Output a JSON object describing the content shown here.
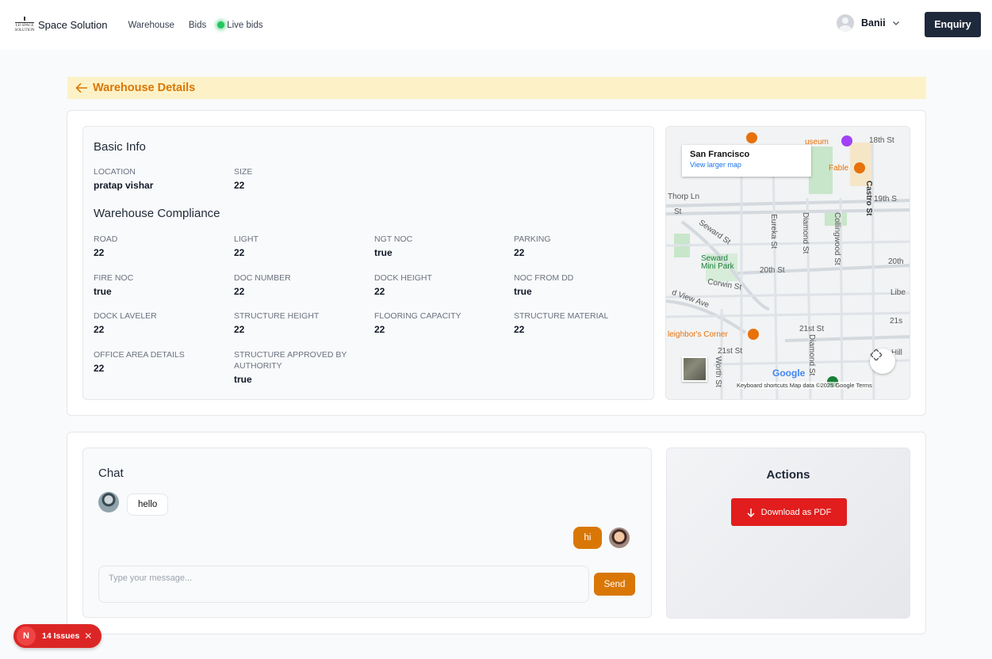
{
  "nav": {
    "logo_line1": "LIJ SPACE",
    "logo_line2": "SOLUTION",
    "brand": "Space Solution",
    "links": [
      "Warehouse",
      "Bids"
    ],
    "live_label": "Live bids",
    "user_name": "Banii",
    "enquiry_label": "Enquiry"
  },
  "header": {
    "back_label": "Warehouse Details"
  },
  "basic_info": {
    "title": "Basic Info",
    "fields": [
      {
        "label": "LOCATION",
        "value": "pratap vishar"
      },
      {
        "label": "SIZE",
        "value": "22"
      }
    ]
  },
  "compliance": {
    "title": "Warehouse Compliance",
    "fields": [
      {
        "label": "ROAD",
        "value": "22"
      },
      {
        "label": "LIGHT",
        "value": "22"
      },
      {
        "label": "NGT NOC",
        "value": "true"
      },
      {
        "label": "PARKING",
        "value": "22"
      },
      {
        "label": "FIRE NOC",
        "value": "true"
      },
      {
        "label": "DOC NUMBER",
        "value": "22"
      },
      {
        "label": "DOCK HEIGHT",
        "value": "22"
      },
      {
        "label": "NOC FROM DD",
        "value": "true"
      },
      {
        "label": "DOCK LAVELER",
        "value": "22"
      },
      {
        "label": "STRUCTURE HEIGHT",
        "value": "22"
      },
      {
        "label": "FLOORING CAPACITY",
        "value": "22"
      },
      {
        "label": "STRUCTURE MATERIAL",
        "value": "22"
      },
      {
        "label": "OFFICE AREA DETAILS",
        "value": "22"
      },
      {
        "label": "STRUCTURE APPROVED BY AUTHORITY",
        "value": "true"
      }
    ]
  },
  "map": {
    "city": "San Francisco",
    "link": "View larger map",
    "labels": {
      "st18": "18th St",
      "museum": "useum",
      "fable": "Fable",
      "st19": "19th S",
      "thorp": "Thorp Ln",
      "st_left": "St",
      "castro": "Castro St",
      "eureka": "Eureka St",
      "diamond": "Diamond St",
      "collingwood": "Collingwood St",
      "seward": "Seward St",
      "park": "Seward Mini Park",
      "st20": "20th St",
      "st20r": "20th",
      "corwin": "Corwin St",
      "view": "d View Ave",
      "liberty": "Libe",
      "neighbors": "leighbor's Corner",
      "st21": "21st St",
      "st21r": "21s",
      "st21l": "21st St",
      "hill": "Hill",
      "worth": "Worth St",
      "diamond2": "Diamond St"
    },
    "google": "Google",
    "footer": "Keyboard shortcuts   Map data ©2025 Google   Terms"
  },
  "chat": {
    "title": "Chat",
    "messages": [
      {
        "from": "other",
        "text": "hello"
      },
      {
        "from": "me",
        "text": "hi"
      }
    ],
    "placeholder": "Type your message...",
    "send_label": "Send"
  },
  "actions": {
    "title": "Actions",
    "download_label": "Download as PDF"
  },
  "issues": {
    "letter": "N",
    "label": "14 Issues"
  },
  "colors": {
    "accent": "#d97706",
    "header_strip": "#fdf2c7",
    "enquiry_bg": "#1e293b",
    "pdf_red": "#e11d1d",
    "live_green": "#22c55e"
  }
}
